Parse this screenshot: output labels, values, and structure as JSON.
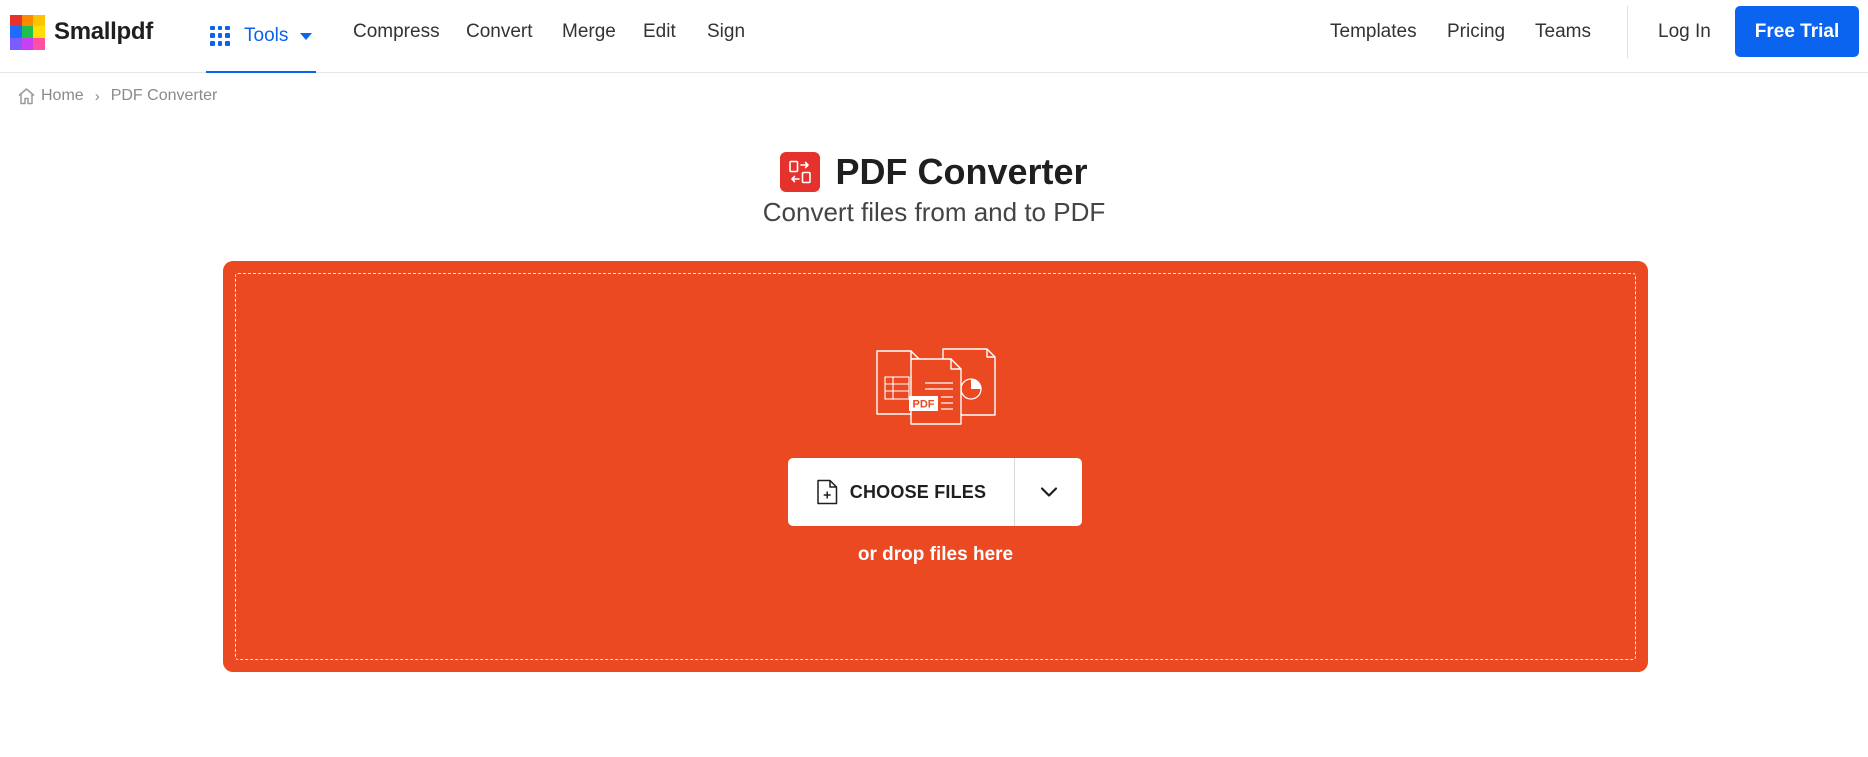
{
  "header": {
    "logo_text": "Smallpdf",
    "tools_label": "Tools",
    "nav_left": [
      "Compress",
      "Convert",
      "Merge",
      "Edit",
      "Sign"
    ],
    "nav_right": [
      "Templates",
      "Pricing",
      "Teams"
    ],
    "login_label": "Log In",
    "trial_label": "Free Trial",
    "brand_color": "#0a64f0"
  },
  "breadcrumb": {
    "home": "Home",
    "separator": "›",
    "current": "PDF Converter"
  },
  "page": {
    "title": "PDF Converter",
    "subtitle": "Convert files from and to PDF",
    "title_icon": "convert-icon",
    "tool_color": "#e5322d"
  },
  "dropzone": {
    "background": "#ea4922",
    "illustration_label": "PDF",
    "choose_label": "CHOOSE FILES",
    "drop_hint": "or drop files here"
  }
}
